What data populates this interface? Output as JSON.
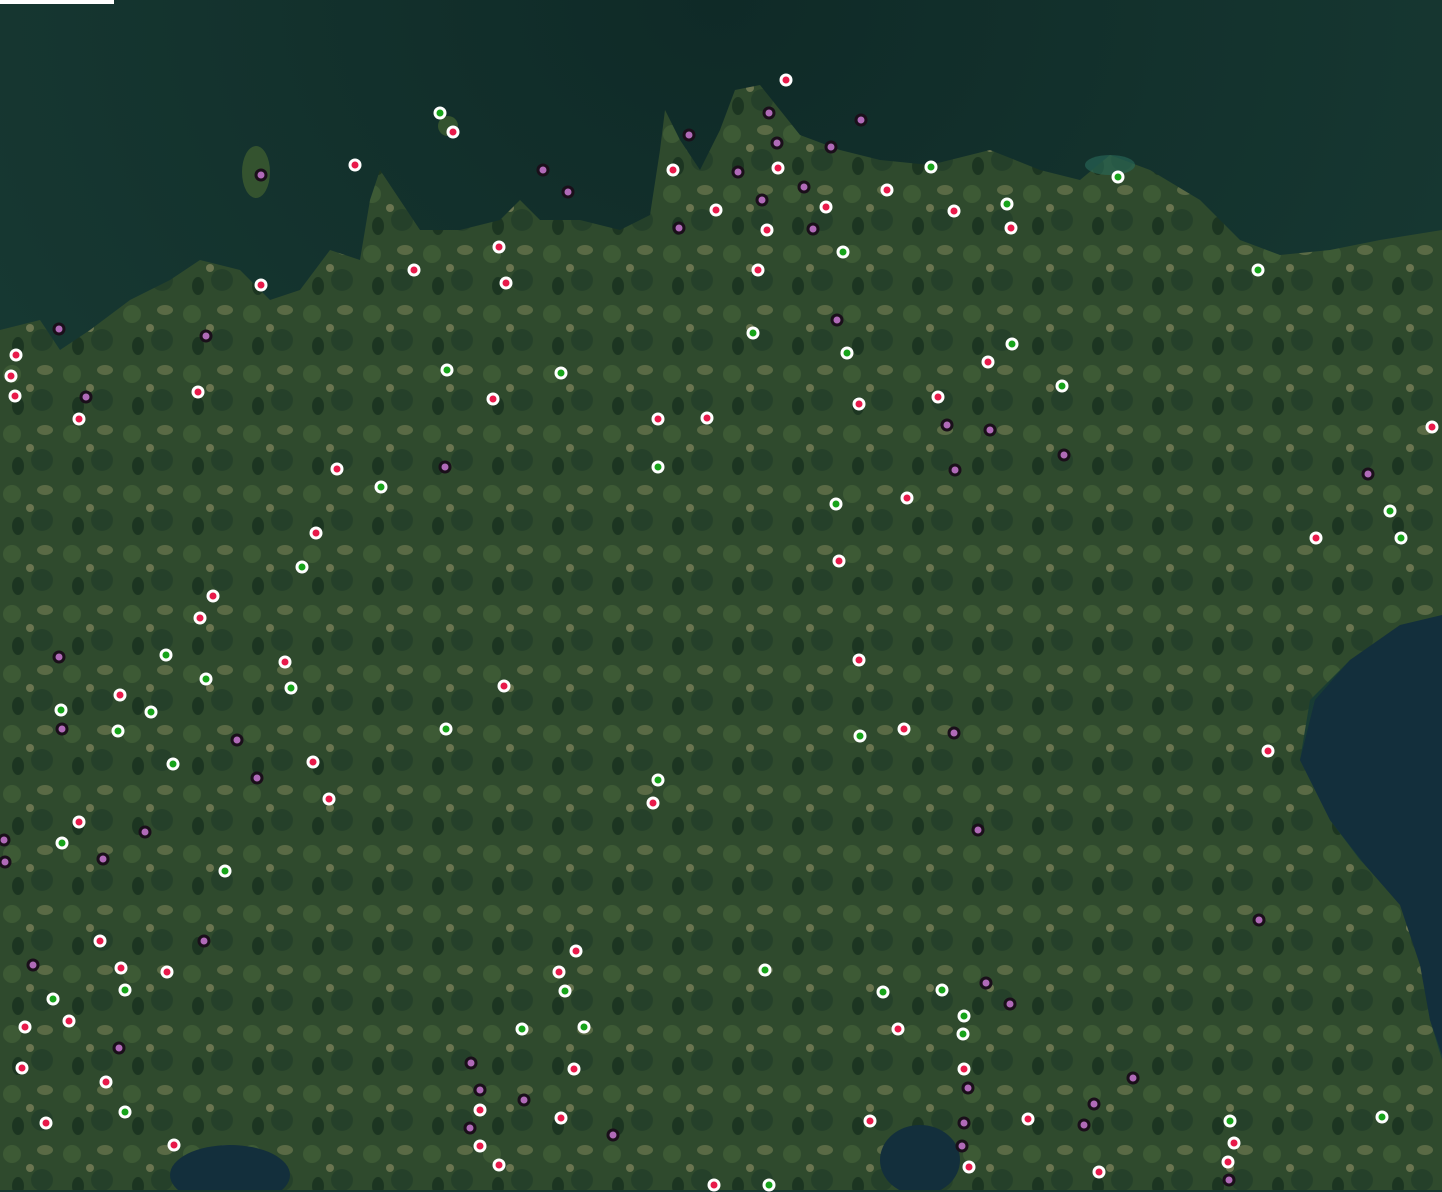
{
  "map": {
    "colors": {
      "sea": "#16372f",
      "sea_deep": "#102a25",
      "land": "#2e4a2c",
      "land_forest": "#1f3a22",
      "lake": "#163a4a",
      "marker_red": "#e8194a",
      "marker_green": "#17a31a",
      "marker_purple": "#b06ab8",
      "marker_outline_light": "#ffffff",
      "marker_outline_dark": "#1a0f1a"
    },
    "marker_types": [
      "red",
      "green",
      "purple"
    ]
  }
}
